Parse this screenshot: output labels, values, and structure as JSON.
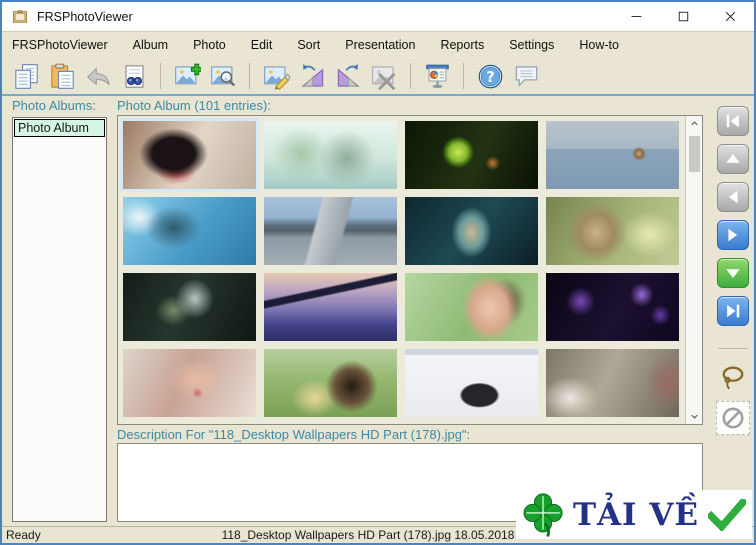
{
  "window": {
    "title": "FRSPhotoViewer",
    "controls": [
      "minimize",
      "maximize",
      "close"
    ]
  },
  "menu": {
    "items": [
      "FRSPhotoViewer",
      "Album",
      "Photo",
      "Edit",
      "Sort",
      "Presentation",
      "Reports",
      "Settings",
      "How-to"
    ]
  },
  "toolbar": {
    "groups": [
      [
        "copy",
        "paste",
        "undo",
        "find"
      ],
      [
        "add-photo",
        "preview-photo"
      ],
      [
        "edit-photo",
        "rotate-left",
        "rotate-right",
        "delete-photo"
      ],
      [
        "presentation"
      ],
      [
        "help",
        "comment"
      ]
    ]
  },
  "sidebar": {
    "label": "Photo Albums:",
    "albums": [
      {
        "name": "Photo Album",
        "selected": true
      }
    ]
  },
  "main": {
    "grid_label": "Photo Album (101 entries):",
    "selected_index": 0,
    "photos": [
      "anime-girl-headphones",
      "floating-islands",
      "green-fruit-branch",
      "boat-at-sea",
      "blue-fantasy-art",
      "highway-cars",
      "teal-fantasy-portrait",
      "anime-girl-green",
      "dark-winged-couple",
      "suspension-bridge-dusk",
      "woman-portrait-green",
      "purple-flowers-dark",
      "woman-behind-net",
      "collie-dog-path",
      "windows-app-screenshot",
      "tabby-cat-closeup"
    ]
  },
  "right_toolbar": {
    "nav_buttons": [
      "first",
      "up",
      "previous",
      "next",
      "down",
      "last"
    ],
    "tools": [
      "lasso",
      "no-tool"
    ]
  },
  "description": {
    "label": "Description For \"118_Desktop Wallpapers  HD Part (178).jpg\":",
    "value": ""
  },
  "status": {
    "left": "Ready",
    "center": "118_Desktop Wallpapers  HD Part (178).jpg  18.05.2018 21:"
  },
  "watermark": {
    "label": "TẢI VỀ"
  },
  "colors": {
    "label_teal": "#3d8aa6",
    "window_border": "#4a82c2",
    "selected_album_bg": "#d5f6e3",
    "nav_blue": "#3a7bd0",
    "nav_green": "#3fae3f"
  }
}
